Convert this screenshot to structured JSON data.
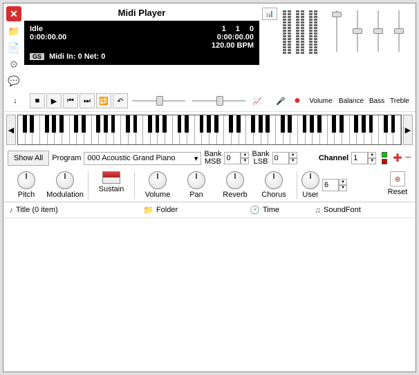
{
  "title": "Midi Player",
  "lcd": {
    "status": "Idle",
    "nums": [
      "1",
      "1",
      "0"
    ],
    "time_elapsed": "0:00:00.00",
    "time_total": "0:00:00.00",
    "bpm": "120.00 BPM",
    "badge": "GS",
    "midi_info": "Midi In: 0   Net: 0"
  },
  "mixer": {
    "labels": [
      "Volume",
      "Balance",
      "Bass",
      "Treble"
    ]
  },
  "controls": {
    "show_all": "Show All",
    "program_label": "Program",
    "program_value": "000 Acoustic Grand Piano",
    "bank_msb_label": "Bank\nMSB",
    "bank_msb": "0",
    "bank_lsb_label": "Bank\nLSB",
    "bank_lsb": "0",
    "channel_label": "Channel",
    "channel": "1"
  },
  "knobs": {
    "pitch": "Pitch",
    "modulation": "Modulation",
    "sustain": "Sustain",
    "volume": "Volume",
    "pan": "Pan",
    "reverb": "Reverb",
    "chorus": "Chorus",
    "user": "User",
    "user_value": "6",
    "reset": "Reset"
  },
  "list": {
    "title_col": "Title  (0 item)",
    "folder_col": "Folder",
    "time_col": "Time",
    "soundfont_col": "SoundFont"
  }
}
